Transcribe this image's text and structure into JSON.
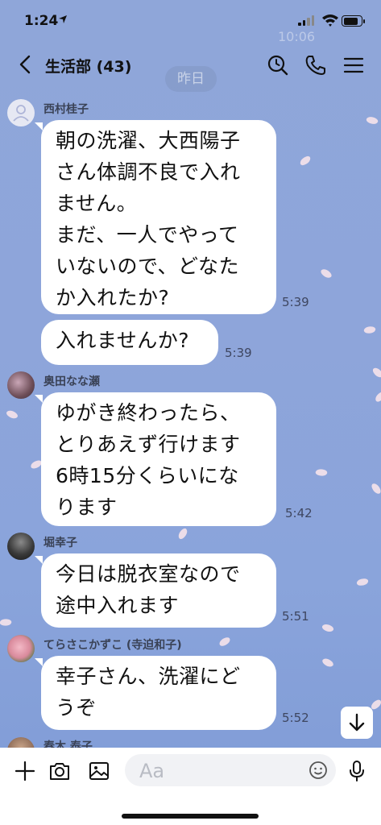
{
  "status_bar": {
    "time": "1:24",
    "location_arrow": "➤"
  },
  "header": {
    "title": "生活部 (43)",
    "date_pill": "昨日",
    "faint_time": "10:06"
  },
  "messages": [
    {
      "sender": "西村桂子",
      "text": "朝の洗濯、大西陽子\nさん体調不良で入れ\nません。\nまだ、一人でやって\nいないので、どなた\nか入れたか?",
      "time": "5:39"
    },
    {
      "sender": "",
      "text": "入れませんか?",
      "time": "5:39"
    },
    {
      "sender": "奥田なな瀬",
      "text": "ゆがき終わったら、\nとりあえず行けます\n6時15分くらいにな\nります",
      "time": "5:42"
    },
    {
      "sender": "堀幸子",
      "text": "今日は脱衣室なので\n途中入れます",
      "time": "5:51"
    },
    {
      "sender": "てらさこかずこ (寺迫和子)",
      "text": "幸子さん、洗濯にど\nうぞ",
      "time": "5:52"
    },
    {
      "sender": "春木 泰子",
      "text": "",
      "time": ""
    }
  ],
  "input": {
    "placeholder": "Aa"
  },
  "icons": {
    "back": "chevron-left-icon",
    "search": "search-clock-icon",
    "call": "phone-icon",
    "menu": "menu-icon",
    "plus": "plus-icon",
    "camera": "camera-icon",
    "image": "image-icon",
    "emoji": "emoji-icon",
    "mic": "mic-icon",
    "scroll": "arrow-down-icon"
  },
  "colors": {
    "background": "#8ea5da",
    "bubble": "#ffffff",
    "input_bar": "#ffffff"
  }
}
